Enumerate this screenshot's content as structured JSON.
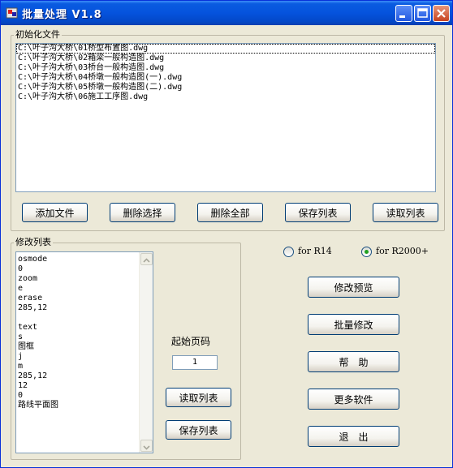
{
  "window": {
    "title": "批量处理 V1.8"
  },
  "colors": {
    "titlebar": "#0553dd",
    "accent": "#21a121",
    "face": "#ece9d8"
  },
  "init_group": {
    "legend": "初始化文件",
    "files": [
      "C:\\叶子沟大桥\\01桥型布置图.dwg",
      "C:\\叶子沟大桥\\02箱梁一般构造图.dwg",
      "C:\\叶子沟大桥\\03桥台一般构造图.dwg",
      "C:\\叶子沟大桥\\04桥墩一般构造图(一).dwg",
      "C:\\叶子沟大桥\\05桥墩一般构造图(二).dwg",
      "C:\\叶子沟大桥\\06施工工序图.dwg"
    ],
    "buttons": {
      "add": "添加文件",
      "delete_selected": "删除选择",
      "delete_all": "删除全部",
      "save_list": "保存列表",
      "read_list": "读取列表"
    }
  },
  "modify_group": {
    "legend": "修改列表",
    "lines": [
      "osmode",
      "0",
      "zoom",
      "e",
      "erase",
      "285,12",
      "",
      "text",
      "s",
      "图框",
      "j",
      "m",
      "285,12",
      "12",
      "0",
      "路线平面图"
    ],
    "start_page_label": "起始页码",
    "start_page_value": "1",
    "buttons": {
      "read_list": "读取列表",
      "save_list": "保存列表"
    }
  },
  "version_options": {
    "r14": "for R14",
    "r2000": "for R2000+",
    "selected": "r2000"
  },
  "actions": {
    "preview": "修改预览",
    "batch": "批量修改",
    "help": "帮　助",
    "more": "更多软件",
    "exit": "退　出"
  },
  "icons": [
    "app-icon",
    "minimize-icon",
    "maximize-icon",
    "close-icon",
    "scroll-up-icon",
    "scroll-down-icon"
  ]
}
